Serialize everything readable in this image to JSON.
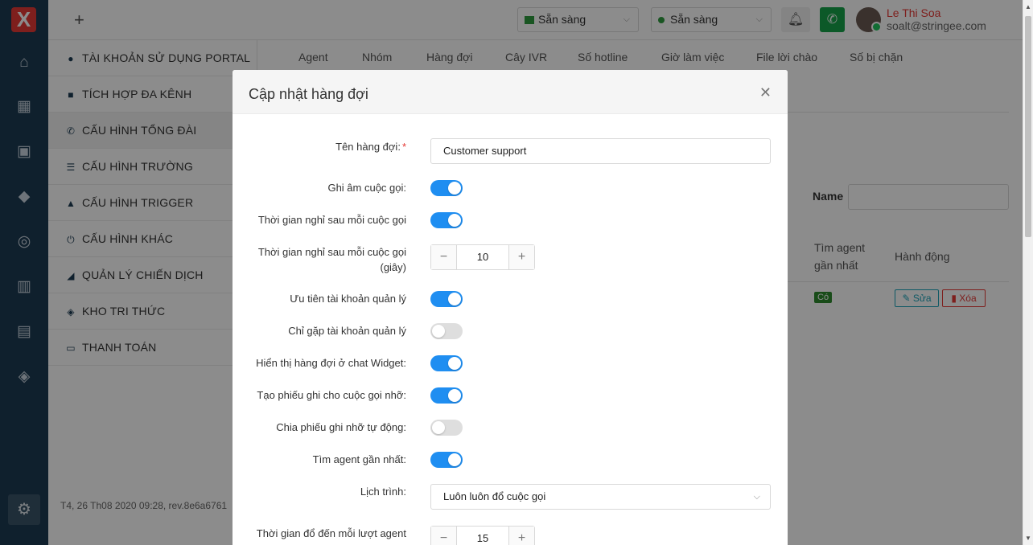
{
  "header": {
    "add_label": "+",
    "status1": "Sẵn sàng",
    "status2": "Sẵn sàng",
    "user_name": "Le Thi Soa",
    "user_email": "soalt@stringee.com"
  },
  "rail": {
    "logo": "X",
    "icons": [
      "home-icon",
      "building-icon",
      "contact-icon",
      "tag-icon",
      "support-icon",
      "chart-icon",
      "chat-icon",
      "book-icon",
      "settings-icon"
    ]
  },
  "sidebar": {
    "items": [
      {
        "label": "TÀI KHOẢN SỬ DỤNG PORTAL",
        "icon": "user-icon"
      },
      {
        "label": "TÍCH HỢP ĐA KÊNH",
        "icon": "grid-icon"
      },
      {
        "label": "CẤU HÌNH TỔNG ĐÀI",
        "icon": "phone-icon"
      },
      {
        "label": "CẤU HÌNH TRƯỜNG",
        "icon": "list-icon"
      },
      {
        "label": "CẤU HÌNH TRIGGER",
        "icon": "bell-icon"
      },
      {
        "label": "CẤU HÌNH KHÁC",
        "icon": "power-icon"
      },
      {
        "label": "QUẢN LÝ CHIẾN DỊCH",
        "icon": "signal-icon"
      },
      {
        "label": "KHO TRI THỨC",
        "icon": "book-icon"
      },
      {
        "label": "THANH TOÁN",
        "icon": "card-icon"
      }
    ],
    "version": "T4, 26 Th08 2020 09:28, rev.8e6a6761"
  },
  "tabs": [
    "Agent",
    "Nhóm",
    "Hàng đợi",
    "Cây IVR",
    "Số hotline",
    "Giờ làm việc",
    "File lời chào",
    "Số bị chặn"
  ],
  "background": {
    "name_label": "Name",
    "col_nearest": "Tìm agent gần nhất",
    "col_action": "Hành động",
    "badge": "Có",
    "edit": "Sửa",
    "delete": "Xóa"
  },
  "modal": {
    "title": "Cập nhật hàng đợi",
    "queue_name_label": "Tên hàng đợi:",
    "queue_name_required": "*",
    "queue_name_value": "Customer support",
    "record_label": "Ghi âm cuộc gọi:",
    "record_on": true,
    "rest_after_call_label": "Thời gian nghỉ sau mỗi cuộc gọi",
    "rest_after_call_on": true,
    "rest_seconds_label": "Thời gian nghỉ sau mỗi cuộc gọi (giây)",
    "rest_seconds_value": "10",
    "priority_manager_label": "Ưu tiên tài khoản quản lý",
    "priority_manager_on": true,
    "only_manager_label": "Chỉ gặp tài khoản quản lý",
    "only_manager_on": false,
    "show_widget_label": "Hiển thị hàng đợi ở chat Widget:",
    "show_widget_on": true,
    "missed_ticket_label": "Tạo phiếu ghi cho cuộc gọi nhỡ:",
    "missed_ticket_on": true,
    "auto_assign_label": "Chia phiếu ghi nhỡ tự động:",
    "auto_assign_on": false,
    "nearest_agent_label": "Tìm agent gần nhất:",
    "nearest_agent_on": true,
    "schedule_label": "Lịch trình:",
    "schedule_value": "Luôn luôn đổ cuộc gọi",
    "ring_time_label": "Thời gian đổ đến mỗi lượt agent",
    "ring_time_value": "15"
  }
}
